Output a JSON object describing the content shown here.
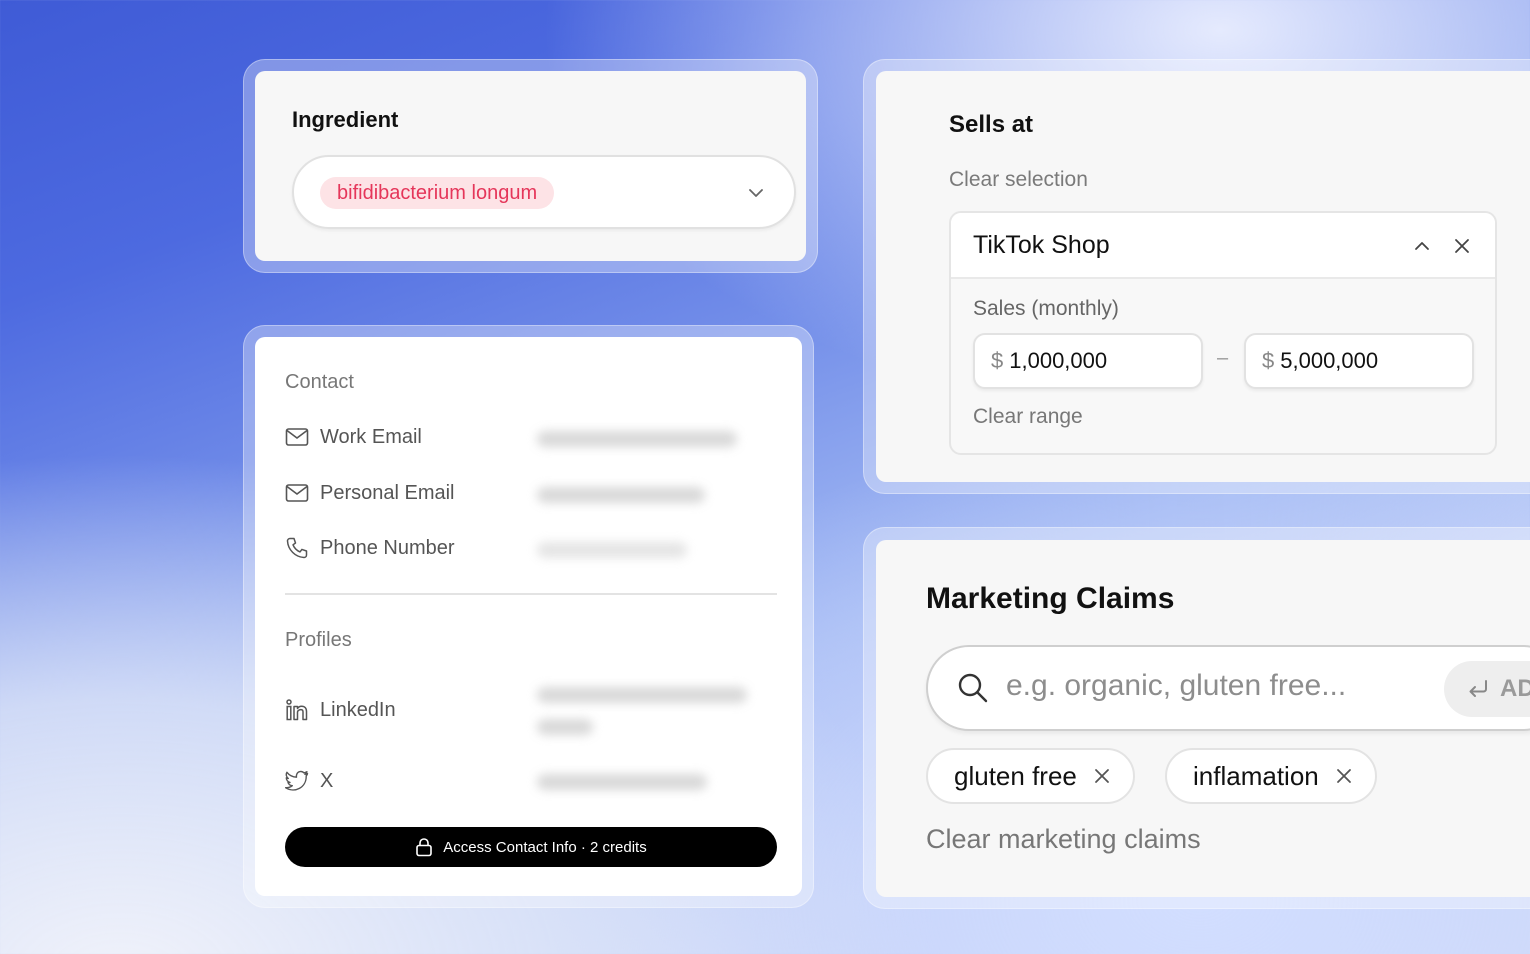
{
  "ingredient": {
    "title": "Ingredient",
    "selected": "bifidibacterium longum"
  },
  "contact": {
    "section_label": "Contact",
    "rows": [
      {
        "label": "Work Email",
        "icon": "mail-icon"
      },
      {
        "label": "Personal Email",
        "icon": "mail-icon"
      },
      {
        "label": "Phone Number",
        "icon": "phone-icon"
      }
    ],
    "profiles_label": "Profiles",
    "profiles": [
      {
        "label": "LinkedIn",
        "icon": "linkedin-icon"
      },
      {
        "label": "X",
        "icon": "twitter-bird-icon"
      }
    ],
    "access_button": "Access Contact Info · 2 credits"
  },
  "sells_at": {
    "title": "Sells at",
    "clear_selection": "Clear selection",
    "shop_name": "TikTok Shop",
    "sales_label": "Sales (monthly)",
    "currency": "$",
    "min_value": "1,000,000",
    "max_value": "5,000,000",
    "range_separator": "–",
    "clear_range": "Clear range"
  },
  "marketing": {
    "title": "Marketing Claims",
    "placeholder": "e.g. organic, gluten free...",
    "add_label": "AD",
    "tags": [
      "gluten free",
      "inflamation"
    ],
    "clear_label": "Clear marketing claims"
  },
  "colors": {
    "accent_pink_bg": "#fde3e6",
    "accent_pink_text": "#e5365a",
    "button_black": "#000000"
  }
}
